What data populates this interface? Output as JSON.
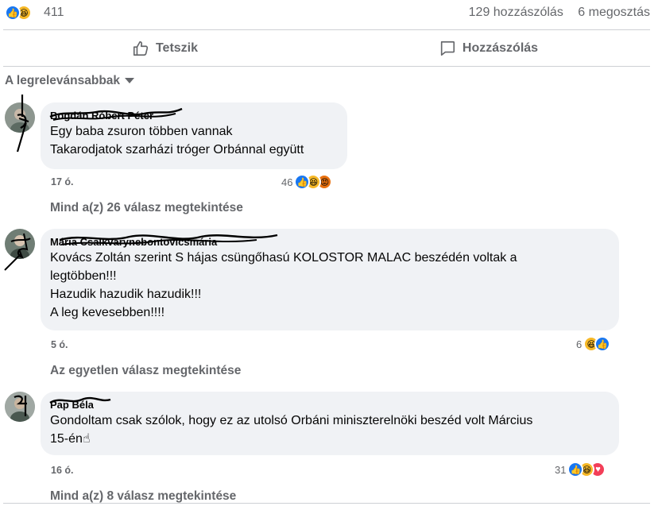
{
  "post": {
    "reaction_count": "411",
    "comments_count": "129 hozzászólás",
    "shares_count": "6 megosztás",
    "reaction_icons": [
      "like-icon",
      "haha-icon"
    ]
  },
  "actions": {
    "like_label": "Tetszik",
    "comment_label": "Hozzászólás"
  },
  "sort": {
    "label": "A legrelevánsabbak"
  },
  "comments": [
    {
      "author": "Bogdán Róbert Péter",
      "lines": [
        "Egy baba zsuron többen vannak",
        "Takarodjatok szarházi tróger Orbánnal együtt"
      ],
      "time": "17 ó.",
      "reaction_count": "46",
      "reaction_icons": [
        "like-icon",
        "haha-icon",
        "angry-icon"
      ],
      "replies_label": "Mind a(z) 26 válasz megtekintése"
    },
    {
      "author": "Mária Csalkvarynebontovicsmária",
      "lines": [
        "Kovács Zoltán szerint S hájas csüngőhasú KOLOSTOR MALAC beszédén voltak a",
        "legtöbben!!!",
        "Hazudik hazudik hazudik!!!",
        "A leg kevesebben!!!!"
      ],
      "time": "5 ó.",
      "reaction_count": "6",
      "reaction_icons": [
        "haha-icon",
        "like-icon"
      ],
      "replies_label": "Az egyetlen válasz megtekintése"
    },
    {
      "author": "Pap Béla",
      "lines": [
        "Gondoltam csak szólok, hogy ez az utolsó Orbáni miniszterelnöki beszéd volt Március",
        "15-én☝"
      ],
      "time": "16 ó.",
      "reaction_count": "31",
      "reaction_icons": [
        "like-icon",
        "haha-icon",
        "love-icon"
      ],
      "replies_label": "Mind a(z) 8 válasz megtekintése"
    }
  ],
  "colors": {
    "accent": "#1877f2",
    "secondary_text": "#65676b",
    "bubble_bg": "#f0f2f5",
    "divider": "#ced0d4"
  }
}
